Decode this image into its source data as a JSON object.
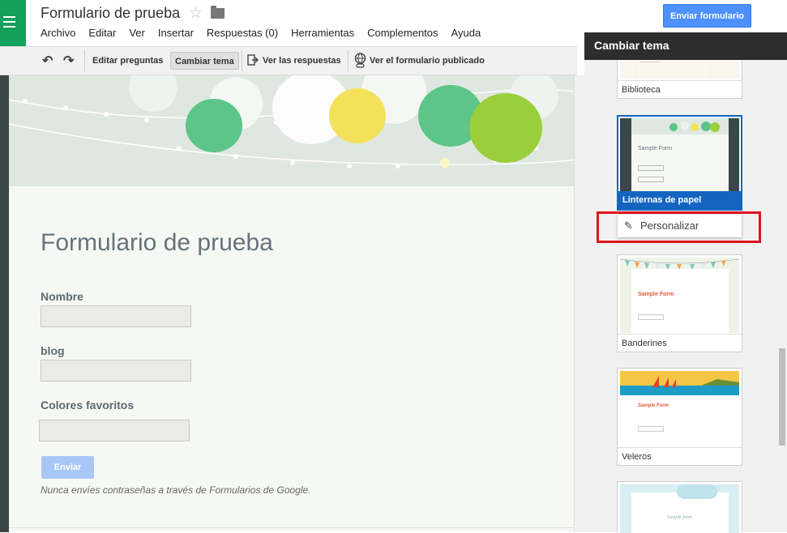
{
  "app": {
    "title": "Formulario de prueba",
    "send_label": "Enviar formulario"
  },
  "menu": [
    "Archivo",
    "Editar",
    "Ver",
    "Insertar",
    "Respuestas (0)",
    "Herramientas",
    "Complementos",
    "Ayuda"
  ],
  "toolbar": {
    "edit_questions": "Editar preguntas",
    "change_theme": "Cambiar tema",
    "view_responses": "Ver las respuestas",
    "view_published": "Ver el formulario publicado"
  },
  "form": {
    "title": "Formulario de prueba",
    "questions": [
      {
        "label": "Nombre",
        "value": ""
      },
      {
        "label": "blog",
        "value": ""
      },
      {
        "label": "Colores favoritos",
        "value": ""
      }
    ],
    "submit_label": "Enviar",
    "disclaimer": "Nunca envíes contraseñas a través de Formularios de Google."
  },
  "panel": {
    "title": "Cambiar tema",
    "customize_label": "Personalizar",
    "themes": [
      {
        "name": "Biblioteca",
        "selected": false
      },
      {
        "name": "Linternas de papel",
        "selected": true
      },
      {
        "name": "Banderines",
        "selected": false
      },
      {
        "name": "Veleros",
        "selected": false
      },
      {
        "name": "",
        "selected": false
      }
    ],
    "sample_title": "Sample Form",
    "sample_script": "Sample form"
  },
  "colors": {
    "accent": "#4d90fe",
    "selected_theme": "#1565c0",
    "highlight": "#e0141d",
    "form_title": "#66737b"
  }
}
